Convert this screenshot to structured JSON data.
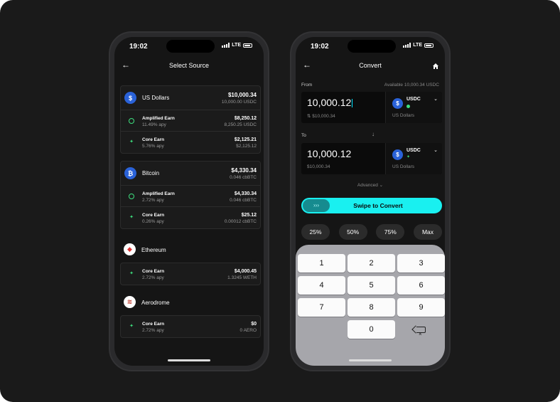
{
  "left": {
    "status": {
      "time": "19:02",
      "network": "LTE"
    },
    "nav": {
      "back": "←",
      "title": "Select Source"
    },
    "groups": [
      {
        "name": "US Dollars",
        "icon": "usdc-icon",
        "glyph": "$",
        "value": "$10,000.34",
        "sub": "10,000.00 USDC",
        "bare": false,
        "earn": [
          {
            "name": "Amplified Earn",
            "apy": "11.49% apy",
            "value": "$8,250.12",
            "sub": "8,250.25 USDC",
            "icon": "amplified-earn-icon"
          },
          {
            "name": "Core Earn",
            "apy": "5.76% apy",
            "value": "$2,125.21",
            "sub": "$2,125.12",
            "icon": "core-earn-icon"
          }
        ]
      },
      {
        "name": "Bitcoin",
        "icon": "bitcoin-icon",
        "glyph": "₿",
        "value": "$4,330.34",
        "sub": "0.046 cbBTC",
        "bare": false,
        "earn": [
          {
            "name": "Amplified Earn",
            "apy": "2.72% apy",
            "value": "$4,330.34",
            "sub": "0.046 cbBTC",
            "icon": "amplified-earn-icon"
          },
          {
            "name": "Core Earn",
            "apy": "0.26% apy",
            "value": "$25.12",
            "sub": "0.00012 cbBTC",
            "icon": "core-earn-icon"
          }
        ]
      },
      {
        "name": "Ethereum",
        "icon": "ethereum-icon",
        "glyph": "◆",
        "bare": true,
        "earn": [
          {
            "name": "Core Earn",
            "apy": "2.72% apy",
            "value": "$4,000.45",
            "sub": "1.3245 WETH",
            "icon": "core-earn-icon"
          }
        ]
      },
      {
        "name": "Aerodrome",
        "icon": "aerodrome-icon",
        "glyph": "≋",
        "bare": true,
        "earn": [
          {
            "name": "Core Earn",
            "apy": "2.72% apy",
            "value": "$0",
            "sub": "0 AERO",
            "icon": "core-earn-icon"
          }
        ]
      }
    ]
  },
  "right": {
    "status": {
      "time": "19:02",
      "network": "LTE"
    },
    "nav": {
      "back": "←",
      "title": "Convert"
    },
    "from": {
      "label": "From",
      "available": "Available 10,000.34 USDC",
      "amount": "10,000.12",
      "fiat": "⇅ $10,000.34",
      "token": "USDC",
      "token_sub": "US Dollars"
    },
    "to": {
      "label": "To",
      "amount": "10,000.12",
      "fiat": "$10,000.34",
      "token": "USDC",
      "token_sub": "US Dollars"
    },
    "arrow": "↓",
    "advanced": "Advanced ⌄",
    "swipe": {
      "knob": "›››",
      "label": "Swipe to Convert"
    },
    "percents": [
      "25%",
      "50%",
      "75%",
      "Max"
    ],
    "keys": [
      "1",
      "2",
      "3",
      "4",
      "5",
      "6",
      "7",
      "8",
      "9",
      "0"
    ],
    "colors": {
      "accent": "#19f0f0",
      "earn": "#3ee07f",
      "usdc": "#2a62d8"
    }
  }
}
